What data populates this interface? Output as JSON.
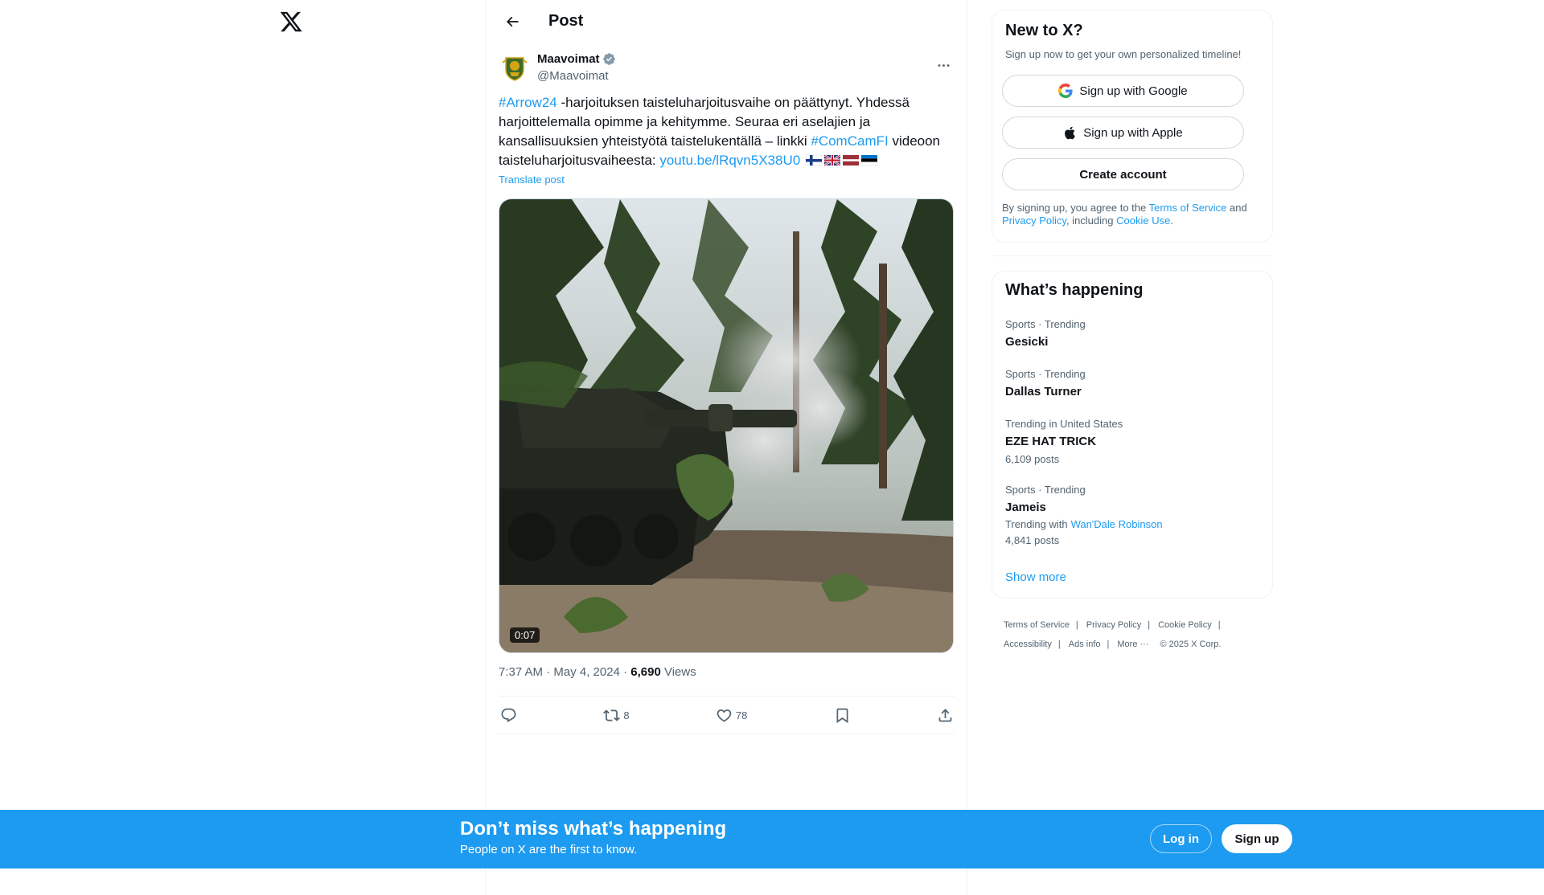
{
  "post_header": {
    "title": "Post"
  },
  "author": {
    "name": "Maavoimat",
    "handle": "@Maavoimat"
  },
  "post": {
    "hashtag1": "#Arrow24",
    "text1": " -harjoituksen taisteluharjoitusvaihe on päättynyt. Yhdessä harjoittelemalla opimme ja kehitymme. Seuraa eri aselajien ja kansallisuuksien yhteistyötä taistelukentällä – linkki ",
    "hashtag2": "#ComCamFI",
    "text2": " videoon taisteluharjoitusvaiheesta: ",
    "link": "youtu.be/lRqvn5X38U0",
    "translate": "Translate post",
    "video_duration": "0:07"
  },
  "meta": {
    "time_date": "7:37 AM · May 4, 2024 · ",
    "views_count": "6,690",
    "views_label": " Views"
  },
  "actions": {
    "retweets": "8",
    "likes": "78"
  },
  "signup": {
    "title": "New to X?",
    "subtitle": "Sign up now to get your own personalized timeline!",
    "google": "Sign up with Google",
    "apple": "Sign up with Apple",
    "create": "Create account",
    "legal1": "By signing up, you agree to the ",
    "tos": "Terms of Service",
    "legal2": " and ",
    "privacy": "Privacy Policy",
    "legal3": ", including ",
    "cookie": "Cookie Use",
    "legal4": "."
  },
  "trends": {
    "title": "What’s happening",
    "items": [
      {
        "category": "Sports · Trending",
        "name": "Gesicki"
      },
      {
        "category": "Sports · Trending",
        "name": "Dallas Turner"
      },
      {
        "category": "Trending in United States",
        "name": "EZE HAT TRICK",
        "posts": "6,109 posts"
      },
      {
        "category": "Sports · Trending",
        "name": "Jameis",
        "with_label": "Trending with",
        "with_link": "Wan'Dale Robinson",
        "posts": "4,841 posts"
      }
    ],
    "show_more": "Show more"
  },
  "footer": {
    "tos": "Terms of Service",
    "privacy": "Privacy Policy",
    "cookie": "Cookie Policy",
    "accessibility": "Accessibility",
    "ads": "Ads info",
    "more": "More ···",
    "copyright": "© 2025 X Corp."
  },
  "bottom_bar": {
    "title": "Don’t miss what’s happening",
    "subtitle": "People on X are the first to know.",
    "login": "Log in",
    "signup": "Sign up"
  },
  "colors": {
    "accent": "#1d9bf0",
    "text": "#0f1419",
    "muted": "#536471",
    "border": "#eff3f4"
  }
}
